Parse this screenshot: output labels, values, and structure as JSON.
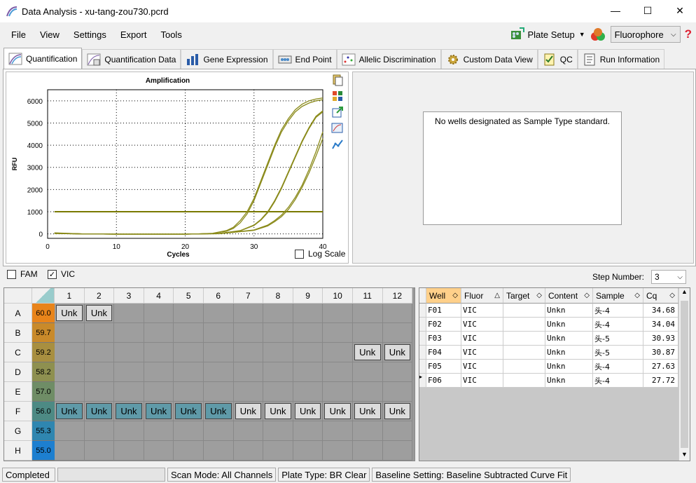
{
  "window": {
    "title": "Data Analysis - xu-tang-zou730.pcrd",
    "minimize": "—",
    "maximize": "☐",
    "close": "✕"
  },
  "menu": [
    "File",
    "View",
    "Settings",
    "Export",
    "Tools"
  ],
  "toolbar": {
    "plate_setup": "Plate Setup",
    "fluorophore": "Fluorophore",
    "help": "?"
  },
  "tabs": [
    "Quantification",
    "Quantification Data",
    "Gene Expression",
    "End Point",
    "Allelic Discrimination",
    "Custom Data View",
    "QC",
    "Run Information"
  ],
  "chart_data": {
    "type": "line",
    "title": "Amplification",
    "xlabel": "Cycles",
    "ylabel": "RFU",
    "xlim": [
      0,
      40
    ],
    "ylim": [
      -200,
      6500
    ],
    "xticks": [
      0,
      10,
      20,
      30,
      40
    ],
    "yticks": [
      0,
      1000,
      2000,
      3000,
      4000,
      5000,
      6000
    ],
    "threshold": 1000,
    "series": [
      {
        "values_x": [
          1,
          5,
          10,
          15,
          20,
          22,
          24,
          26,
          27,
          28,
          29,
          30,
          31,
          32,
          33,
          34,
          35,
          36,
          37,
          38,
          39,
          40
        ],
        "values_y": [
          50,
          0,
          -10,
          -10,
          -10,
          0,
          30,
          150,
          300,
          600,
          1000,
          1600,
          2400,
          3200,
          4000,
          4700,
          5200,
          5600,
          5850,
          6000,
          6080,
          6130
        ]
      },
      {
        "values_x": [
          1,
          5,
          10,
          15,
          20,
          22,
          24,
          26,
          27,
          28,
          29,
          30,
          31,
          32,
          33,
          34,
          35,
          36,
          37,
          38,
          39,
          40
        ],
        "values_y": [
          40,
          0,
          -10,
          -10,
          -10,
          0,
          20,
          120,
          250,
          500,
          900,
          1500,
          2300,
          3100,
          3900,
          4600,
          5100,
          5500,
          5750,
          5900,
          6000,
          6050
        ]
      },
      {
        "values_x": [
          1,
          5,
          10,
          15,
          20,
          25,
          28,
          30,
          31,
          32,
          33,
          34,
          35,
          36,
          37,
          38,
          39,
          40
        ],
        "values_y": [
          30,
          0,
          -10,
          -10,
          -10,
          20,
          150,
          400,
          650,
          1000,
          1500,
          2100,
          2800,
          3500,
          4200,
          4800,
          5300,
          5550
        ]
      },
      {
        "values_x": [
          1,
          5,
          10,
          15,
          20,
          25,
          28,
          30,
          31,
          32,
          33,
          34,
          35,
          36,
          37,
          38,
          39,
          40
        ],
        "values_y": [
          30,
          0,
          -10,
          -10,
          -10,
          20,
          140,
          380,
          620,
          960,
          1450,
          2050,
          2750,
          3450,
          4150,
          4750,
          5250,
          5500
        ]
      },
      {
        "values_x": [
          1,
          5,
          10,
          15,
          20,
          25,
          30,
          32,
          33,
          34,
          35,
          36,
          37,
          38,
          39,
          40
        ],
        "values_y": [
          20,
          0,
          -10,
          -10,
          -10,
          10,
          180,
          400,
          600,
          850,
          1200,
          1650,
          2200,
          2900,
          3700,
          4600
        ]
      },
      {
        "values_x": [
          1,
          5,
          10,
          15,
          20,
          25,
          30,
          32,
          33,
          34,
          35,
          36,
          37,
          38,
          39,
          40
        ],
        "values_y": [
          20,
          0,
          -10,
          -10,
          -10,
          10,
          160,
          360,
          550,
          780,
          1100,
          1550,
          2100,
          2750,
          3500,
          4300
        ]
      }
    ],
    "color": "#8a8a1a",
    "threshold_color": "#7a7a00"
  },
  "log_scale": "Log Scale",
  "no_wells": "No wells designated as Sample Type standard.",
  "checks": {
    "fam": "FAM",
    "vic": "VIC",
    "fam_checked": false,
    "vic_checked": true
  },
  "step": {
    "label": "Step Number:",
    "value": "3"
  },
  "plate": {
    "cols": [
      "1",
      "2",
      "3",
      "4",
      "5",
      "6",
      "7",
      "8",
      "9",
      "10",
      "11",
      "12"
    ],
    "rows": [
      {
        "letter": "A",
        "temp": "60.0",
        "color": "#e8841a"
      },
      {
        "letter": "B",
        "temp": "59.7",
        "color": "#c98a2a"
      },
      {
        "letter": "C",
        "temp": "59.2",
        "color": "#a88f40"
      },
      {
        "letter": "D",
        "temp": "58.2",
        "color": "#8e9050"
      },
      {
        "letter": "E",
        "temp": "57.0",
        "color": "#6f8d66"
      },
      {
        "letter": "F",
        "temp": "56.0",
        "color": "#4d8a84"
      },
      {
        "letter": "G",
        "temp": "55.3",
        "color": "#2f86b0"
      },
      {
        "letter": "H",
        "temp": "55.0",
        "color": "#1d7fd0"
      }
    ],
    "unk": "Unk"
  },
  "table": {
    "headers": [
      "Well",
      "Fluor",
      "Target",
      "Content",
      "Sample",
      "Cq"
    ],
    "rows": [
      [
        "F01",
        "VIC",
        "",
        "Unkn",
        "头-4",
        "34.68"
      ],
      [
        "F02",
        "VIC",
        "",
        "Unkn",
        "头-4",
        "34.04"
      ],
      [
        "F03",
        "VIC",
        "",
        "Unkn",
        "头-5",
        "30.93"
      ],
      [
        "F04",
        "VIC",
        "",
        "Unkn",
        "头-5",
        "30.87"
      ],
      [
        "F05",
        "VIC",
        "",
        "Unkn",
        "头-4",
        "27.63"
      ],
      [
        "F06",
        "VIC",
        "",
        "Unkn",
        "头-4",
        "27.72"
      ]
    ]
  },
  "status": {
    "completed": "Completed",
    "scan": "Scan Mode: All Channels",
    "plate_type": "Plate Type: BR Clear",
    "baseline": "Baseline Setting: Baseline Subtracted Curve Fit"
  }
}
